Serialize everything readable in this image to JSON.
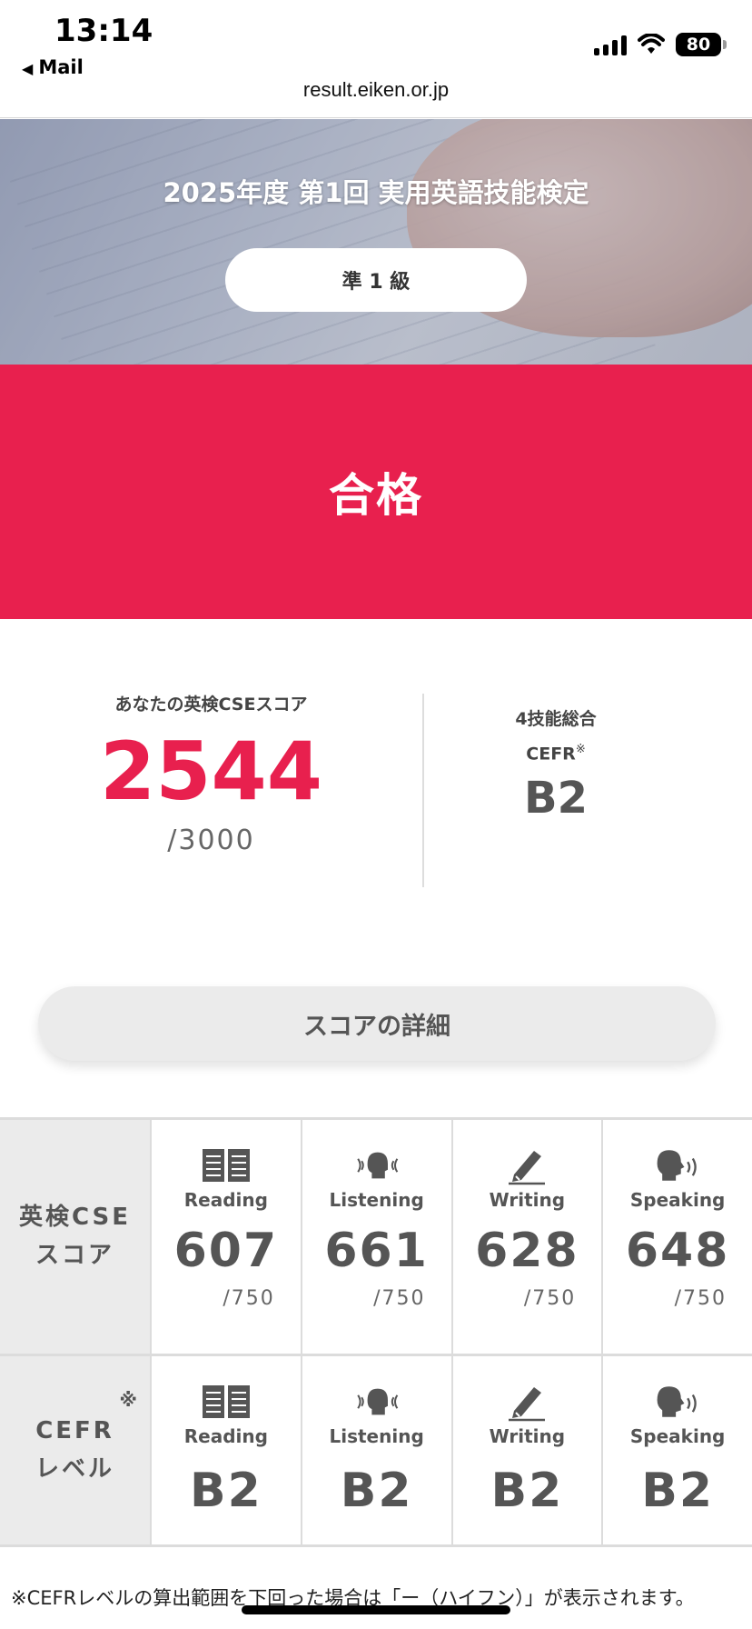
{
  "status_bar": {
    "time": "13:14",
    "back_label": "Mail",
    "battery": "80",
    "url": "result.eiken.or.jp"
  },
  "hero": {
    "title": "2025年度 第1回 実用英語技能検定",
    "grade": "準 1 級"
  },
  "result": {
    "label": "合格",
    "color": "#e8204e"
  },
  "score": {
    "label": "あなたの英検CSEスコア",
    "value": "2544",
    "max": "/3000"
  },
  "cefr_overall": {
    "title": "4技能総合",
    "label": "CEFR",
    "mark": "※",
    "value": "B2"
  },
  "detail_button": "スコアの詳細",
  "table": {
    "cse_header": [
      "英検CSE",
      "スコア"
    ],
    "cefr_header": [
      "CEFR",
      "レベル"
    ],
    "cefr_mark": "※",
    "skills": [
      {
        "name": "Reading",
        "icon": "book-icon",
        "score": "607",
        "max": "/750",
        "cefr": "B2"
      },
      {
        "name": "Listening",
        "icon": "listening-head-icon",
        "score": "661",
        "max": "/750",
        "cefr": "B2"
      },
      {
        "name": "Writing",
        "icon": "pencil-icon",
        "score": "628",
        "max": "/750",
        "cefr": "B2"
      },
      {
        "name": "Speaking",
        "icon": "speaking-head-icon",
        "score": "648",
        "max": "/750",
        "cefr": "B2"
      }
    ]
  },
  "note": "※CEFRレベルの算出範囲を下回った場合は「ー（ハイフン）」が表示されます。"
}
